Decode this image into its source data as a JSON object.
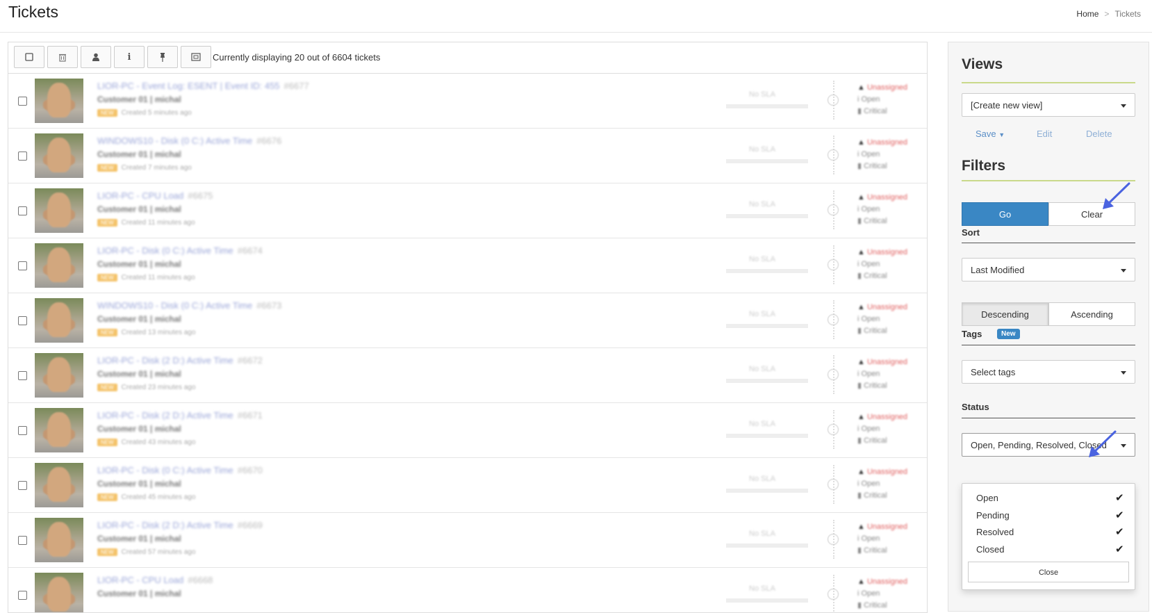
{
  "header": {
    "title": "Tickets",
    "breadcrumb": [
      "Home",
      "Tickets"
    ],
    "breadcrumb_sep": ">"
  },
  "toolbar": {
    "buttons": [
      "checkbox-icon",
      "trash-icon",
      "user-icon",
      "info-icon",
      "pin-icon",
      "expand-icon"
    ],
    "info": "Currently displaying 20 out of 6604 tickets"
  },
  "tickets": [
    {
      "subject": "LIOR-PC - Event Log: ESENT | Event ID: 455",
      "number": "#6677",
      "customer": "Customer 01 | michal",
      "badge": "NEW",
      "created": "Created 5 minutes ago",
      "sla": "No SLA",
      "assignee": "Unassigned",
      "status": "Open",
      "priority": "Critical"
    },
    {
      "subject": "WINDOWS10 - Disk (0 C:) Active Time",
      "number": "#6676",
      "customer": "Customer 01 | michal",
      "badge": "NEW",
      "created": "Created 7 minutes ago",
      "sla": "No SLA",
      "assignee": "Unassigned",
      "status": "Open",
      "priority": "Critical"
    },
    {
      "subject": "LIOR-PC - CPU Load",
      "number": "#6675",
      "customer": "Customer 01 | michal",
      "badge": "NEW",
      "created": "Created 11 minutes ago",
      "sla": "No SLA",
      "assignee": "Unassigned",
      "status": "Open",
      "priority": "Critical"
    },
    {
      "subject": "LIOR-PC - Disk (0 C:) Active Time",
      "number": "#6674",
      "customer": "Customer 01 | michal",
      "badge": "NEW",
      "created": "Created 11 minutes ago",
      "sla": "No SLA",
      "assignee": "Unassigned",
      "status": "Open",
      "priority": "Critical"
    },
    {
      "subject": "WINDOWS10 - Disk (0 C:) Active Time",
      "number": "#6673",
      "customer": "Customer 01 | michal",
      "badge": "NEW",
      "created": "Created 13 minutes ago",
      "sla": "No SLA",
      "assignee": "Unassigned",
      "status": "Open",
      "priority": "Critical"
    },
    {
      "subject": "LIOR-PC - Disk (2 D:) Active Time",
      "number": "#6672",
      "customer": "Customer 01 | michal",
      "badge": "NEW",
      "created": "Created 23 minutes ago",
      "sla": "No SLA",
      "assignee": "Unassigned",
      "status": "Open",
      "priority": "Critical"
    },
    {
      "subject": "LIOR-PC - Disk (2 D:) Active Time",
      "number": "#6671",
      "customer": "Customer 01 | michal",
      "badge": "NEW",
      "created": "Created 43 minutes ago",
      "sla": "No SLA",
      "assignee": "Unassigned",
      "status": "Open",
      "priority": "Critical"
    },
    {
      "subject": "LIOR-PC - Disk (0 C:) Active Time",
      "number": "#6670",
      "customer": "Customer 01 | michal",
      "badge": "NEW",
      "created": "Created 45 minutes ago",
      "sla": "No SLA",
      "assignee": "Unassigned",
      "status": "Open",
      "priority": "Critical"
    },
    {
      "subject": "LIOR-PC - Disk (2 D:) Active Time",
      "number": "#6669",
      "customer": "Customer 01 | michal",
      "badge": "NEW",
      "created": "Created 57 minutes ago",
      "sla": "No SLA",
      "assignee": "Unassigned",
      "status": "Open",
      "priority": "Critical"
    },
    {
      "subject": "LIOR-PC - CPU Load",
      "number": "#6668",
      "customer": "Customer 01 | michal",
      "badge": "",
      "created": "",
      "sla": "No SLA",
      "assignee": "Unassigned",
      "status": "Open",
      "priority": "Critical"
    }
  ],
  "sidebar": {
    "views": {
      "title": "Views",
      "selected": "[Create new view]",
      "save": "Save",
      "edit": "Edit",
      "delete": "Delete"
    },
    "filters": {
      "title": "Filters",
      "go": "Go",
      "clear": "Clear",
      "sort": {
        "label": "Sort",
        "selected": "Last Modified",
        "descending": "Descending",
        "ascending": "Ascending",
        "active": "descending"
      },
      "tags": {
        "label": "Tags",
        "badge": "New",
        "placeholder": "Select tags"
      },
      "status": {
        "label": "Status",
        "selected": "Open, Pending, Resolved, Closed",
        "options": [
          {
            "label": "Open",
            "checked": true
          },
          {
            "label": "Pending",
            "checked": true
          },
          {
            "label": "Resolved",
            "checked": true
          },
          {
            "label": "Closed",
            "checked": true
          }
        ],
        "close": "Close"
      }
    },
    "annotation_color": "#4a63e0"
  }
}
